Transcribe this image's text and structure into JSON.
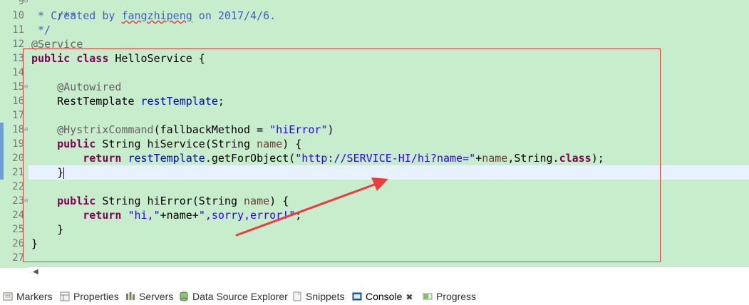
{
  "editor": {
    "line_numbers": [
      "9",
      "10",
      "11",
      "12",
      "13",
      "14",
      "15",
      "16",
      "17",
      "18",
      "19",
      "20",
      "21",
      "22",
      "23",
      "24",
      "25",
      "26",
      "27"
    ],
    "code": {
      "l9": "/**",
      "l10_prefix": " * Created by ",
      "l10_author": "fangzhipeng",
      "l10_suffix": " on 2017/4/6.",
      "l11": " */",
      "l12": "@Service",
      "kw_public": "public",
      "kw_class": "class",
      "kw_return": "return",
      "kw_classlit": "class",
      "l13_name": " HelloService {",
      "l15": "@Autowired",
      "l16_type": "RestTemplate ",
      "l16_field": "restTemplate",
      "semicolon": ";",
      "l18_ann": "@HystrixCommand",
      "l18_mid": "(fallbackMethod = ",
      "l18_str": "\"hiError\"",
      "l18_end": ")",
      "l19_sig": " String hiService(String ",
      "param_name": "name",
      "l19_end": ") {",
      "l20_field": "restTemplate",
      "l20_call": ".getForObject(",
      "l20_str": "\"http://SERVICE-HI/hi?name=\"",
      "l20_plus": "+",
      "l20_comma": ",String.",
      "l20_end": ");",
      "l21": "}",
      "l23_sig": " String hiError(String ",
      "l24_str1": "\"hi,\"",
      "l24_plus1": "+name+",
      "l24_str2": "\",sorry,error!\"",
      "close_brace": "}"
    }
  },
  "bottom_tabs": [
    {
      "label": "Markers",
      "icon": "markers-icon"
    },
    {
      "label": "Properties",
      "icon": "properties-icon"
    },
    {
      "label": "Servers",
      "icon": "servers-icon"
    },
    {
      "label": "Data Source Explorer",
      "icon": "data-source-explorer-icon"
    },
    {
      "label": "Snippets",
      "icon": "snippets-icon"
    },
    {
      "label": "Console",
      "icon": "console-icon",
      "active": true,
      "close": "✖"
    },
    {
      "label": "Progress",
      "icon": "progress-icon"
    }
  ],
  "colors": {
    "editor_bg": "#c7edcc",
    "highlight_box": "#e53b3b",
    "arrow": "#ee3b3b",
    "keyword": "#7f0055",
    "string": "#2a00ff",
    "comment": "#3f5fbf"
  }
}
